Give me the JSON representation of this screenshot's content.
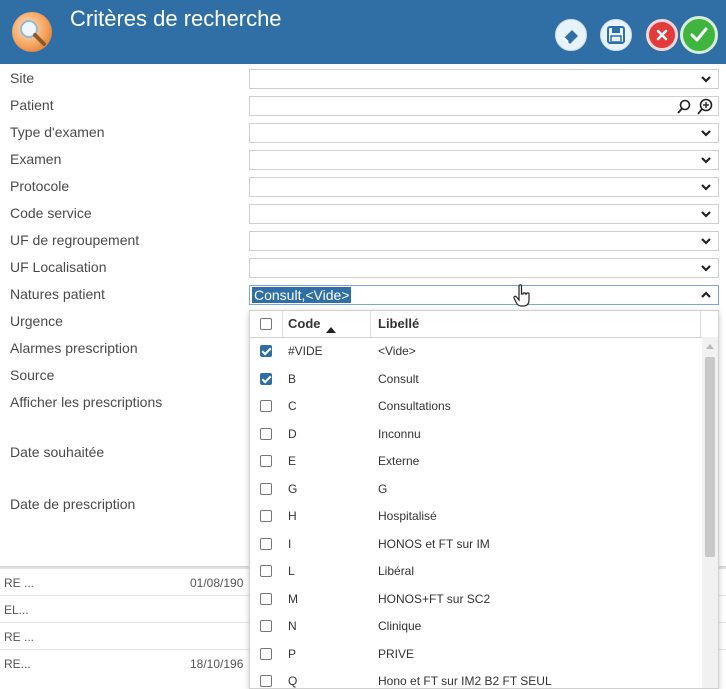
{
  "header": {
    "title": "Critères de recherche",
    "colors": {
      "bar": "#2f6fa6",
      "cancel": "#e13b3b",
      "validate": "#3fb43f"
    }
  },
  "form": {
    "labels": [
      "Site",
      "Patient",
      "Type d'examen",
      "Examen",
      "Protocole",
      "Code service",
      "UF de regroupement",
      "UF Localisation",
      "Natures patient",
      "Urgence",
      "Alarmes prescription",
      "Source",
      "Afficher les prescriptions",
      "Date souhaitée",
      "Date de prescription"
    ],
    "natures_value": "Consult,<Vide>"
  },
  "dropdown": {
    "headers": {
      "code": "Code",
      "libelle": "Libellé"
    },
    "rows": [
      {
        "code": "#VIDE",
        "libelle": "<Vide>",
        "checked": true
      },
      {
        "code": "B",
        "libelle": "Consult",
        "checked": true
      },
      {
        "code": "C",
        "libelle": "Consultations",
        "checked": false
      },
      {
        "code": "D",
        "libelle": "Inconnu",
        "checked": false
      },
      {
        "code": "E",
        "libelle": "Externe",
        "checked": false
      },
      {
        "code": "G",
        "libelle": "G",
        "checked": false
      },
      {
        "code": "H",
        "libelle": "Hospitalisé",
        "checked": false
      },
      {
        "code": "I",
        "libelle": "HONOS et FT sur IM",
        "checked": false
      },
      {
        "code": "L",
        "libelle": "Libéral",
        "checked": false
      },
      {
        "code": "M",
        "libelle": "HONOS+FT sur SC2",
        "checked": false
      },
      {
        "code": "N",
        "libelle": "Clinique",
        "checked": false
      },
      {
        "code": "P",
        "libelle": "PRIVE",
        "checked": false
      },
      {
        "code": "Q",
        "libelle": "Hono et FT sur IM2 B2 FT SEUL",
        "checked": false
      }
    ]
  },
  "grid": {
    "rows": [
      {
        "name": "RE ...",
        "date": "01/08/190"
      },
      {
        "name": "EL...",
        "date": ""
      },
      {
        "name": "RE ...",
        "date": ""
      },
      {
        "name": "RE...",
        "date": "18/10/196"
      }
    ]
  }
}
